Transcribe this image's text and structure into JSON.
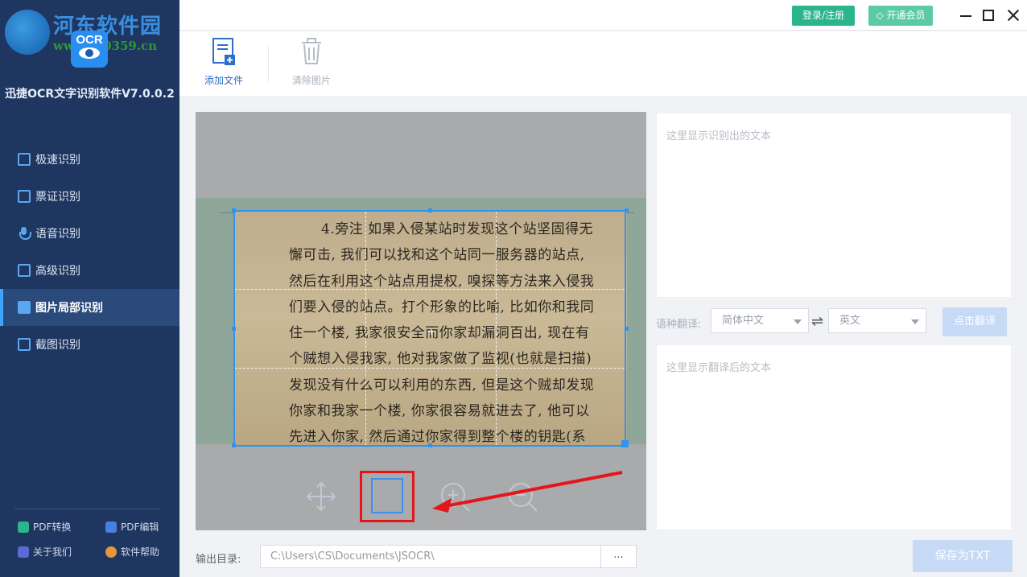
{
  "watermark": {
    "title": "河东软件园",
    "url": "www.pc0359.cn"
  },
  "logo": {
    "text": "OCR"
  },
  "app_name": "迅捷OCR文字识别软件V7.0.0.2",
  "nav": [
    {
      "label": "极速识别",
      "icon": "fast-recognize-icon"
    },
    {
      "label": "票证识别",
      "icon": "ticket-icon"
    },
    {
      "label": "语音识别",
      "icon": "microphone-icon"
    },
    {
      "label": "高级识别",
      "icon": "advanced-icon"
    },
    {
      "label": "图片局部识别",
      "icon": "image-icon",
      "active": true
    },
    {
      "label": "截图识别",
      "icon": "screenshot-icon"
    }
  ],
  "footer": [
    {
      "label": "PDF转换",
      "icon": "pdf-convert-icon",
      "color": "#2bb58d"
    },
    {
      "label": "PDF编辑",
      "icon": "pdf-edit-icon",
      "color": "#4a7fe0"
    },
    {
      "label": "关于我们",
      "icon": "about-icon",
      "color": "#5b6bd6"
    },
    {
      "label": "软件帮助",
      "icon": "help-icon",
      "color": "#e8963b"
    }
  ],
  "topbar": {
    "login_label": "登录/注册",
    "vip_label": "开通会员"
  },
  "toolbar": {
    "add_label": "添加文件",
    "clear_label": "清除图片"
  },
  "photo_text": [
    "4.旁注 如果入侵某站时发现这个站坚固得无",
    "懈可击, 我们可以找和这个站同一服务器的站点,",
    "然后在利用这个站点用提权, 嗅探等方法来入侵我",
    "们要入侵的站点。打个形象的比喻, 比如你和我同",
    "住一个楼, 我家很安全而你家却漏洞百出, 现在有",
    "个贼想入侵我家, 他对我家做了监视(也就是扫描)",
    "发现没有什么可以利用的东西, 但是这个贼却发现",
    "你家和我家一个楼, 你家很容易就进去了, 他可以",
    "先进入你家, 然后通过你家得到整个楼的钥匙(系"
  ],
  "ocr_placeholder": "这里显示识别出的文本",
  "translate": {
    "label": "语种翻译:",
    "source": "简体中文",
    "target": "英文",
    "button": "点击翻译",
    "placeholder": "这里显示翻译后的文本"
  },
  "output": {
    "label": "输出目录:",
    "path": "C:\\Users\\CS\\Documents\\JSOCR\\",
    "browse": "...",
    "save_label": "保存为TXT"
  },
  "colors": {
    "sidebar": "#1e3660",
    "accent": "#2f93f0",
    "login": "#2bb58d",
    "vip": "#5ccaa4",
    "highlight": "#e3161b"
  }
}
